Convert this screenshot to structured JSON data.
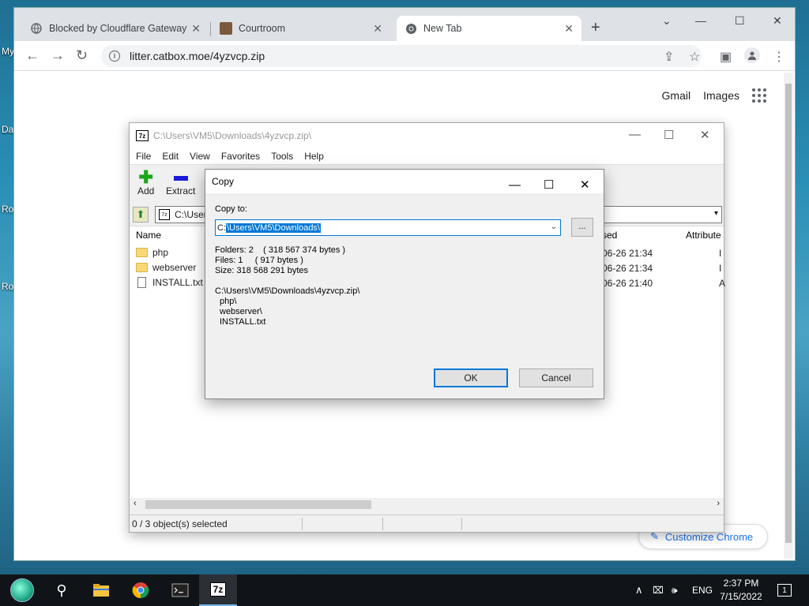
{
  "desktop": {
    "fragments": [
      {
        "text": "My",
        "key": "a"
      },
      {
        "text": "Da",
        "key": "b"
      },
      {
        "text": "Ro",
        "key": "c"
      },
      {
        "text": "Ro",
        "key": "d"
      }
    ]
  },
  "chrome": {
    "tabs": [
      {
        "label": "Blocked by Cloudflare Gateway"
      },
      {
        "label": "Courtroom"
      },
      {
        "label": "New Tab"
      }
    ],
    "url": "litter.catbox.moe/4yzvcp.zip",
    "links": {
      "gmail": "Gmail",
      "images": "Images"
    },
    "customize_label": "Customize Chrome",
    "accent": "#1a73e8"
  },
  "sevenzip": {
    "title": "C:\\Users\\VM5\\Downloads\\4yzvcp.zip\\",
    "menu": [
      "File",
      "Edit",
      "View",
      "Favorites",
      "Tools",
      "Help"
    ],
    "toolbar": {
      "add": "Add",
      "extract": "Extract"
    },
    "address": "C:\\User",
    "columns": {
      "name": "Name",
      "modified": "sed",
      "attributes": "Attribute"
    },
    "rows": [
      {
        "name": "php",
        "type": "folder",
        "date": "06-26 21:34",
        "attr": "I"
      },
      {
        "name": "webserver",
        "type": "folder",
        "date": "06-26 21:34",
        "attr": "I"
      },
      {
        "name": "INSTALL.txt",
        "type": "file",
        "date": "06-26 21:40",
        "attr": "A"
      }
    ],
    "status": "0 / 3 object(s) selected"
  },
  "copy_dialog": {
    "title": "Copy",
    "copy_to_label": "Copy to:",
    "path_prefix": "C:",
    "path_selected": "\\Users\\VM5\\Downloads\\",
    "browse_label": "...",
    "folders_line": "Folders: 2    ( 318 567 374 bytes )",
    "files_line": "Files: 1     ( 917 bytes )",
    "size_line": "Size: 318 568 291 bytes",
    "source_path": "C:\\Users\\VM5\\Downloads\\4yzvcp.zip\\",
    "source_items": [
      "php\\",
      "webserver\\",
      "INSTALL.txt"
    ],
    "ok_label": "OK",
    "cancel_label": "Cancel"
  },
  "taskbar": {
    "language": "ENG",
    "time": "2:37 PM",
    "date": "7/15/2022",
    "notification_count": "1",
    "active_app": "7z"
  }
}
